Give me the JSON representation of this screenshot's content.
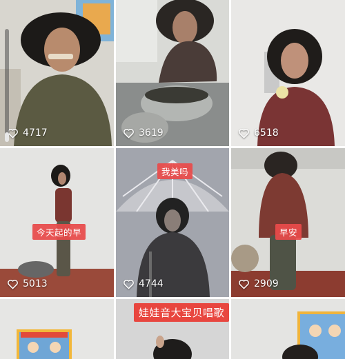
{
  "grid": {
    "tiles": [
      {
        "likes": "4717"
      },
      {
        "likes": "3619"
      },
      {
        "likes": "6518"
      },
      {
        "likes": "5013",
        "caption": "今天起的早"
      },
      {
        "likes": "4744",
        "caption": "我美吗"
      },
      {
        "likes": "2909",
        "caption": "早安"
      },
      {},
      {
        "caption": "娃娃音大宝贝唱歌"
      },
      {}
    ]
  },
  "colors": {
    "caption_bg": "#e8463f",
    "likes_text": "#ffffff"
  },
  "icons": {
    "like": "heart-outline-icon"
  }
}
